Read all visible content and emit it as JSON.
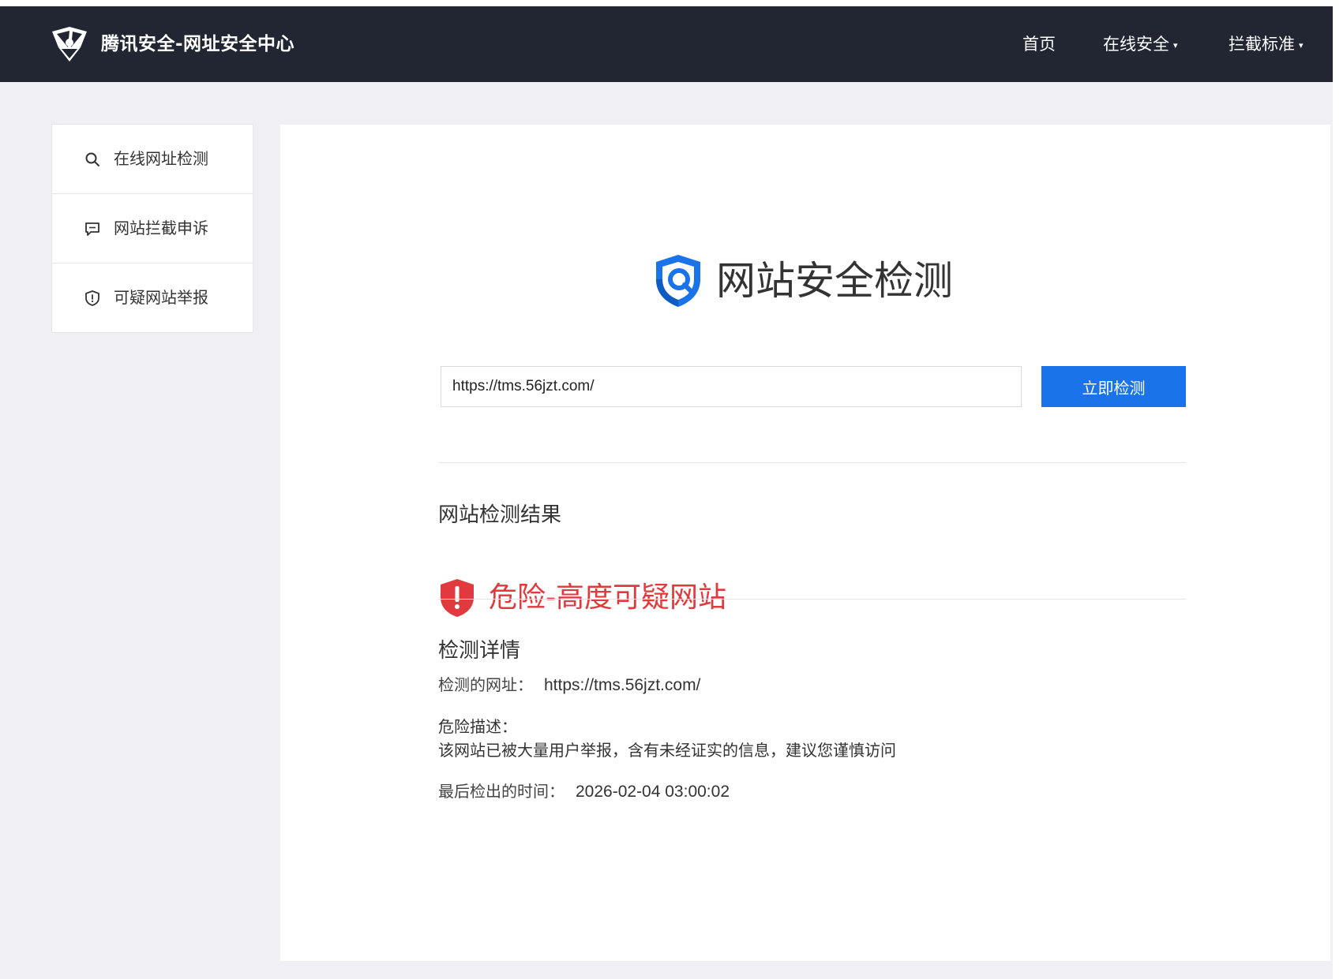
{
  "navbar": {
    "brand": "腾讯安全-网址安全中心",
    "links": [
      {
        "label": "首页",
        "has_caret": false
      },
      {
        "label": "在线安全",
        "has_caret": true
      },
      {
        "label": "拦截标准",
        "has_caret": true
      }
    ],
    "caret_glyph": "▾"
  },
  "sidebar": {
    "items": [
      {
        "label": "在线网址检测",
        "icon": "search-icon"
      },
      {
        "label": "网站拦截申诉",
        "icon": "message-icon"
      },
      {
        "label": "可疑网站举报",
        "icon": "shield-alert-icon"
      }
    ]
  },
  "main": {
    "hero_title": "网站安全检测",
    "search": {
      "value": "https://tms.56jzt.com/",
      "button_label": "立即检测"
    },
    "result": {
      "section_title": "网站检测结果",
      "status_text": "危险-高度可疑网站",
      "status_color": "#e0393e"
    },
    "details": {
      "section_title": "检测详情",
      "url_label": "检测的网址：",
      "url_value": "https://tms.56jzt.com/",
      "desc_label": "危险描述：",
      "desc_text": "该网站已被大量用户举报，含有未经证实的信息，建议您谨慎访问",
      "time_label": "最后检出的时间：",
      "time_value": "2026-02-04 03:00:02"
    }
  },
  "colors": {
    "navbar_bg": "#222632",
    "accent": "#1a73e8",
    "danger": "#e0393e",
    "page_bg": "#f0f0f4"
  }
}
